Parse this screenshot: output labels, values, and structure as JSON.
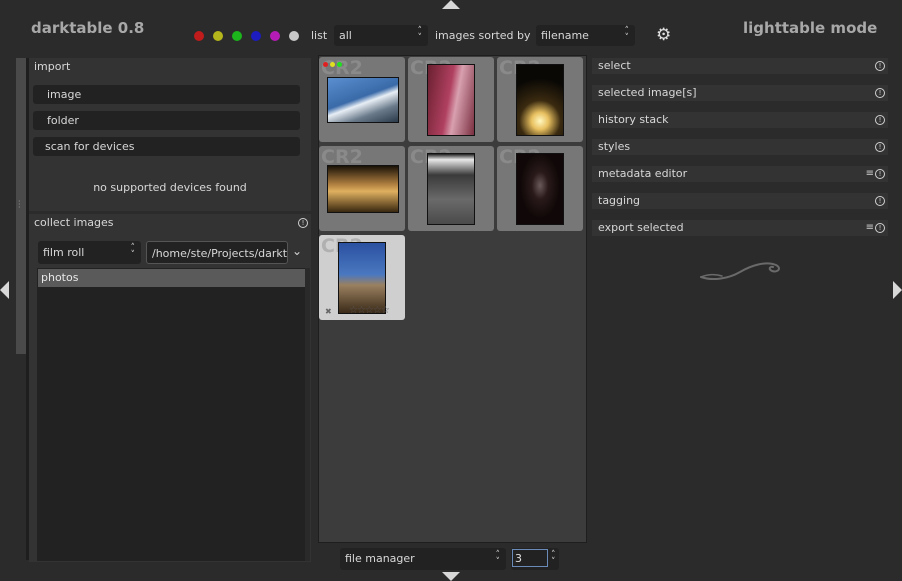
{
  "app": {
    "title": "darktable 0.8",
    "mode": "lighttable mode"
  },
  "top_bar": {
    "color_labels": [
      "#c01c1c",
      "#b5b51c",
      "#1cb51c",
      "#1c1cc0",
      "#b51cb5",
      "#c8c8c8"
    ],
    "view_label": "list",
    "view_value": "all",
    "sort_label": "images sorted by",
    "sort_value": "filename",
    "settings_icon": "gear-icon"
  },
  "left_panel": {
    "import": {
      "title": "import",
      "buttons": [
        "image",
        "folder",
        "scan for devices"
      ],
      "status": "no supported devices found"
    },
    "collect": {
      "title": "collect images",
      "property": "film roll",
      "path": "/home/ste/Projects/darkt",
      "items": [
        "photos"
      ]
    }
  },
  "thumbnails": [
    {
      "badge": "CR2",
      "color": "#4a7ab0",
      "labels": [
        "#e02020",
        "#e0e020",
        "#20e020"
      ]
    },
    {
      "badge": "CR2",
      "color": "#a0405a"
    },
    {
      "badge": "CR2",
      "color": "#c8a040"
    },
    {
      "badge": "CR2",
      "color": "#8a6a30"
    },
    {
      "badge": "CR2",
      "color": "#555555"
    },
    {
      "badge": "CR2",
      "color": "#2a2020"
    },
    {
      "badge": "CR2",
      "color": "#4a6a9a",
      "stars": "☆☆☆☆☆",
      "reject": "✖",
      "selected": true
    }
  ],
  "bottom_bar": {
    "layout_value": "file manager",
    "zoom_value": "3"
  },
  "right_panel": {
    "modules": [
      {
        "label": "select",
        "presets": false
      },
      {
        "label": "selected image[s]",
        "presets": false
      },
      {
        "label": "history stack",
        "presets": false
      },
      {
        "label": "styles",
        "presets": false
      },
      {
        "label": "metadata editor",
        "presets": true
      },
      {
        "label": "tagging",
        "presets": false
      },
      {
        "label": "export selected",
        "presets": true
      }
    ]
  }
}
